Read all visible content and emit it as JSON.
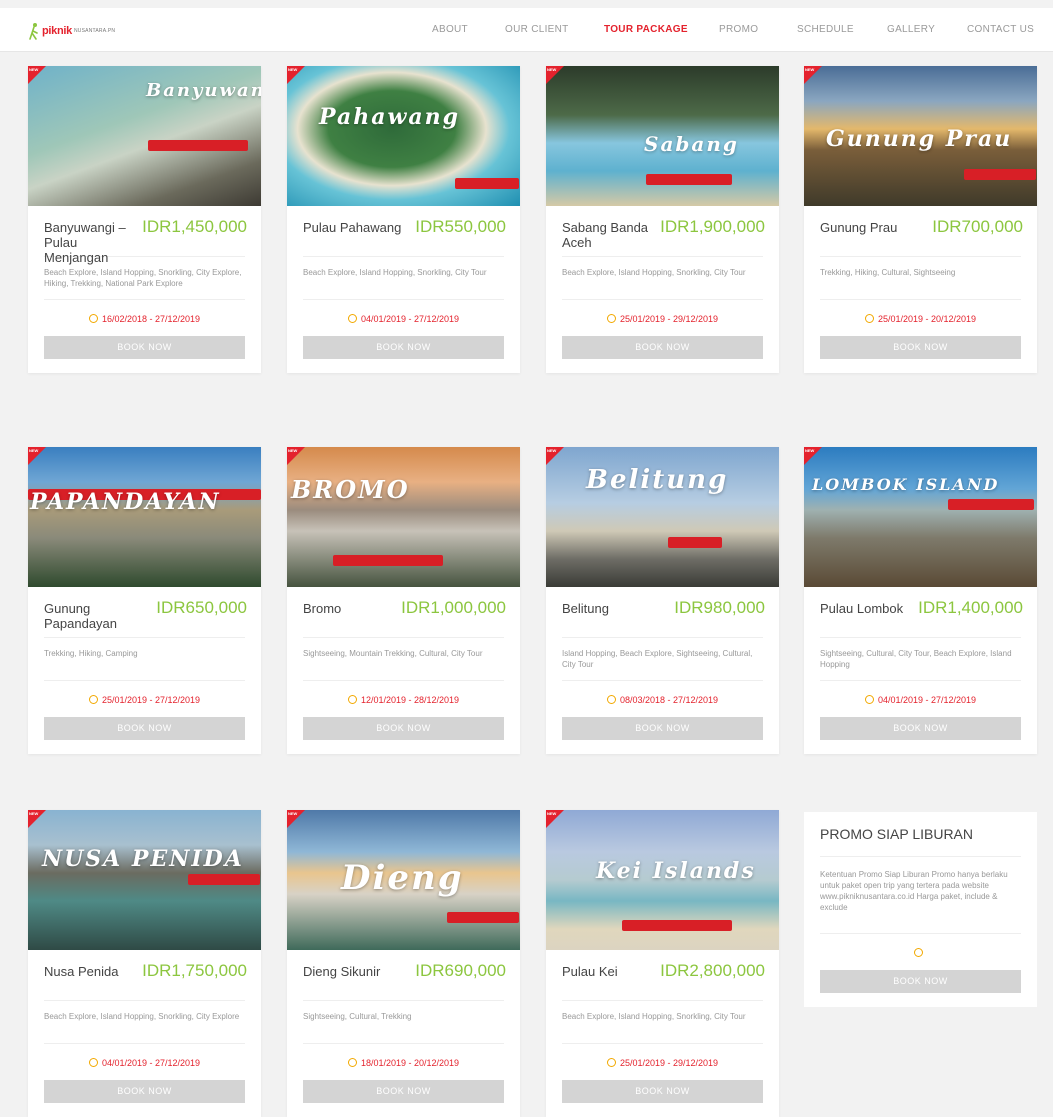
{
  "nav": {
    "logo_text": "piknik",
    "logo_sub": "NUSANTARA.PN",
    "items": [
      {
        "label": "ABOUT"
      },
      {
        "label": "OUR CLIENT"
      },
      {
        "label": "TOUR PACKAGE"
      },
      {
        "label": "PROMO"
      },
      {
        "label": "SCHEDULE"
      },
      {
        "label": "GALLERY"
      },
      {
        "label": "CONTACT US"
      }
    ],
    "active_index": 2
  },
  "colors": {
    "accent": "#e4222d",
    "price": "#8cc63f",
    "button": "#d4d4d4",
    "clock": "#f2a900"
  },
  "ribbon_label": "NEW",
  "book_label": "BOOK NOW",
  "packages": [
    {
      "name": "Banyuwangi – Pulau Menjangan",
      "price": "IDR1,450,000",
      "desc": "Beach Explore, Island Hopping, Snorkling, City Explore, Hiking, Trekking, National Park Explore",
      "date": "16/02/2018 - 27/12/2019",
      "image_title": "Banyuwangi"
    },
    {
      "name": "Pulau Pahawang",
      "price": "IDR550,000",
      "desc": "Beach Explore, Island Hopping, Snorkling, City Tour",
      "date": "04/01/2019 - 27/12/2019",
      "image_title": "Pahawang"
    },
    {
      "name": "Sabang Banda Aceh",
      "price": "IDR1,900,000",
      "desc": "Beach Explore, Island Hopping, Snorkling, City Tour",
      "date": "25/01/2019 - 29/12/2019",
      "image_title": "Sabang"
    },
    {
      "name": "Gunung Prau",
      "price": "IDR700,000",
      "desc": "Trekking, Hiking, Cultural, Sightseeing",
      "date": "25/01/2019 - 20/12/2019",
      "image_title": "Gunung Prau"
    },
    {
      "name": "Gunung Papandayan",
      "price": "IDR650,000",
      "desc": "Trekking, Hiking, Camping",
      "date": "25/01/2019 - 27/12/2019",
      "image_title": "PAPANDAYAN"
    },
    {
      "name": "Bromo",
      "price": "IDR1,000,000",
      "desc": "Sightseeing, Mountain Trekking, Cultural, City Tour",
      "date": "12/01/2019 - 28/12/2019",
      "image_title": "BROMO"
    },
    {
      "name": "Belitung",
      "price": "IDR980,000",
      "desc": "Island Hopping, Beach Explore, Sightseeing, Cultural, City Tour",
      "date": "08/03/2018 - 27/12/2019",
      "image_title": "Belitung"
    },
    {
      "name": "Pulau Lombok",
      "price": "IDR1,400,000",
      "desc": "Sightseeing, Cultural, City Tour, Beach Explore, Island Hopping",
      "date": "04/01/2019 - 27/12/2019",
      "image_title": "LOMBOK ISLAND"
    },
    {
      "name": "Nusa Penida",
      "price": "IDR1,750,000",
      "desc": "Beach Explore, Island Hopping, Snorkling, City Explore",
      "date": "04/01/2019 - 27/12/2019",
      "image_title": "NUSA PENIDA"
    },
    {
      "name": "Dieng Sikunir",
      "price": "IDR690,000",
      "desc": "Sightseeing, Cultural, Trekking",
      "date": "18/01/2019 - 20/12/2019",
      "image_title": "Dieng"
    },
    {
      "name": "Pulau Kei",
      "price": "IDR2,800,000",
      "desc": "Beach Explore, Island Hopping, Snorkling, City Tour",
      "date": "25/01/2019 - 29/12/2019",
      "image_title": "Kei Islands"
    }
  ],
  "promo": {
    "title": "PROMO SIAP LIBURAN",
    "desc": "Ketentuan Promo Siap Liburan Promo hanya berlaku untuk paket open trip yang tertera pada website www.pikniknusantara.co.id Harga paket, include & exclude",
    "button": "BOOK NOW"
  }
}
